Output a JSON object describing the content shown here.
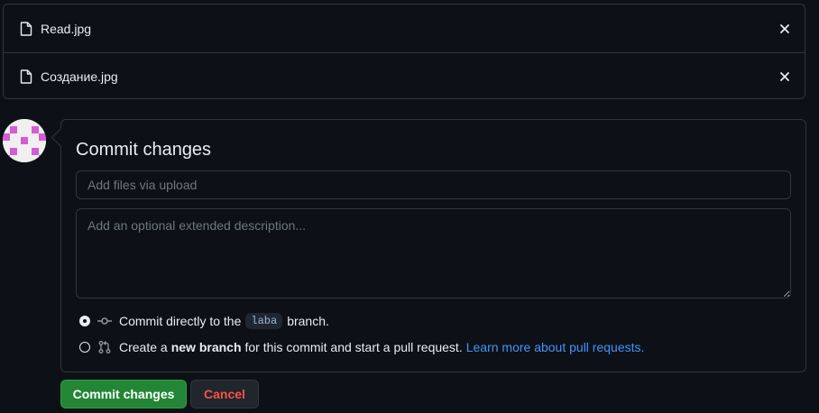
{
  "files": [
    {
      "name": "Read.jpg",
      "icon": "file-icon",
      "remove_icon": "close-icon"
    },
    {
      "name": "Создание.jpg",
      "icon": "file-icon",
      "remove_icon": "close-icon"
    }
  ],
  "commit": {
    "title": "Commit changes",
    "summary_placeholder": "Add files via upload",
    "summary_value": "",
    "description_placeholder": "Add an optional extended description...",
    "description_value": "",
    "options": [
      {
        "selected": true,
        "icon": "git-commit-icon",
        "prefix": "Commit directly to the",
        "branch": "laba",
        "suffix": "branch."
      },
      {
        "selected": false,
        "icon": "git-pull-request-icon",
        "prefix": "Create a",
        "bold": "new branch",
        "suffix": "for this commit and start a pull request.",
        "link": "Learn more about pull requests."
      }
    ]
  },
  "buttons": {
    "commit_label": "Commit changes",
    "cancel_label": "Cancel"
  },
  "colors": {
    "background": "#0d1117",
    "border": "#30363d",
    "accent_green": "#238636",
    "danger_red": "#f85149",
    "link_blue": "#4493f8"
  }
}
